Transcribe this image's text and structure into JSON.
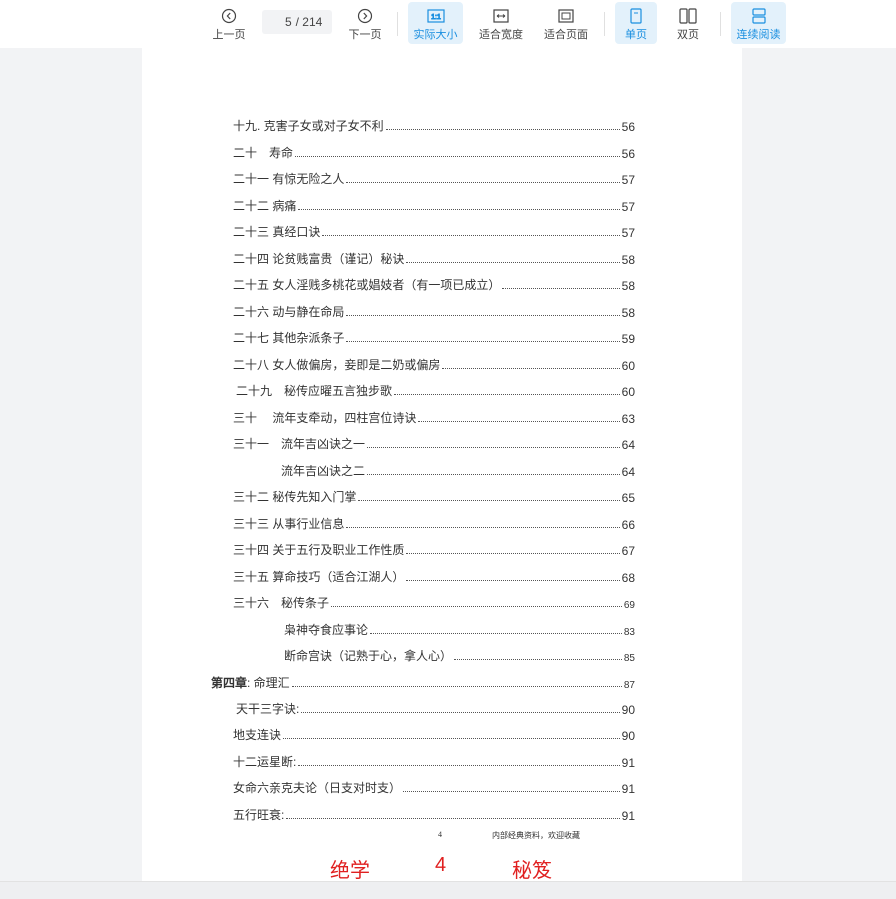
{
  "toolbar": {
    "prev_label": "上一页",
    "next_label": "下一页",
    "current_page": "5",
    "total_pages": "/ 214",
    "actual_size_label": "实际大小",
    "fit_width_label": "适合宽度",
    "fit_page_label": "适合页面",
    "single_page_label": "单页",
    "double_page_label": "双页",
    "continuous_label": "连续阅读"
  },
  "toc": [
    {
      "title": "十九. 克害子女或对子女不利",
      "page": "56"
    },
    {
      "title": "二十　寿命",
      "page": "56"
    },
    {
      "title": "二十一 有惊无险之人",
      "page": "57"
    },
    {
      "title": "二十二 病痛",
      "page": "57"
    },
    {
      "title": "二十三 真经口诀",
      "page": "57"
    },
    {
      "title": "二十四 论贫贱富贵（谨记）秘诀",
      "page": "58"
    },
    {
      "title": "二十五 女人淫贱多桃花或娼妓者（有一项已成立）",
      "page": "58"
    },
    {
      "title": "二十六 动与静在命局",
      "page": "58"
    },
    {
      "title": "二十七 其他杂派条子",
      "page": "59"
    },
    {
      "title": "二十八 女人做偏房，妾即是二奶或偏房",
      "page": "60"
    },
    {
      "title": "二十九　秘传应曜五言独步歌",
      "page": "60"
    },
    {
      "title": "三十　 流年支牵动，四柱宫位诗诀",
      "page": "63"
    },
    {
      "title": "三十一　流年吉凶诀之一",
      "page": "64"
    },
    {
      "title": "流年吉凶诀之二",
      "page": "64"
    },
    {
      "title": "三十二 秘传先知入门掌",
      "page": "65"
    },
    {
      "title": "三十三 从事行业信息",
      "page": "66"
    },
    {
      "title": "三十四 关于五行及职业工作性质",
      "page": "67"
    },
    {
      "title": "三十五 算命技巧（适合江湖人）",
      "page": "68"
    },
    {
      "title": "三十六　秘传条子",
      "page": "69"
    },
    {
      "title": "枭神夺食应事论",
      "page": "83"
    },
    {
      "title": "断命宫诀（记熟于心，拿人心）",
      "page": "85"
    },
    {
      "chapter": "第四章",
      "title": ": 命理汇",
      "page": "87"
    },
    {
      "title": "天干三字诀:",
      "page": "90"
    },
    {
      "title": "地支连诀",
      "page": "90"
    },
    {
      "title": "十二运星断:",
      "page": "91"
    },
    {
      "title": "女命六亲克夫论（日支对时支）",
      "page": "91"
    },
    {
      "title": "五行旺衰:",
      "page": "91"
    }
  ],
  "footer": {
    "page_number": "4",
    "note": "内部经典资料，欢迎收藏"
  },
  "stamp": {
    "left": "绝学",
    "number": "4",
    "right": "秘笈"
  },
  "colors": {
    "accent": "#1a8fe0",
    "active_bg": "#e3f1fb",
    "stamp_red": "#e02020"
  }
}
